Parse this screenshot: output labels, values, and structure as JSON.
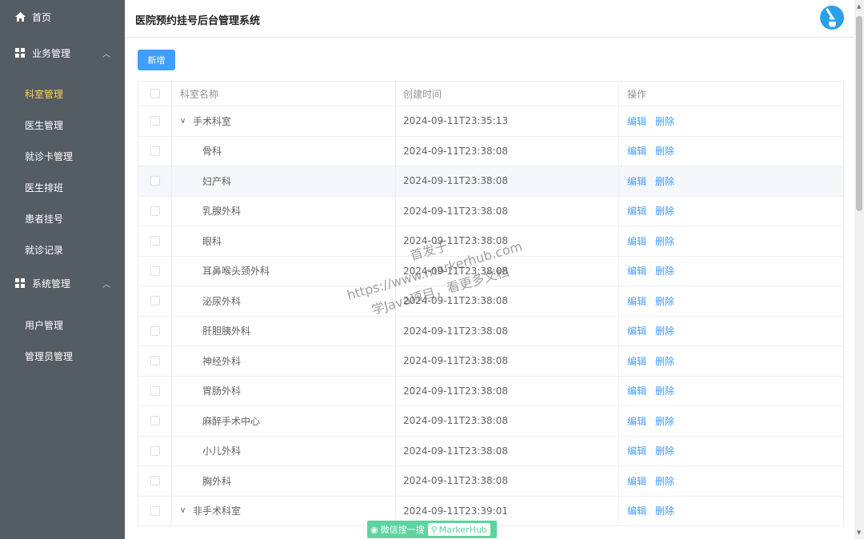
{
  "app": {
    "title": "医院预约挂号后台管理系统"
  },
  "sidebar": {
    "home": "首页",
    "groups": [
      {
        "label": "业务管理",
        "items": [
          "科室管理",
          "医生管理",
          "就诊卡管理",
          "医生排班",
          "患者挂号",
          "就诊记录"
        ]
      },
      {
        "label": "系统管理",
        "items": [
          "用户管理",
          "管理员管理"
        ]
      }
    ],
    "active": "科室管理"
  },
  "toolbar": {
    "add_label": "新增"
  },
  "table": {
    "columns": [
      "科室名称",
      "创建时间",
      "操作"
    ],
    "edit_label": "编辑",
    "delete_label": "删除",
    "rows": [
      {
        "name": "手术科室",
        "time": "2024-09-11T23:35:13",
        "parent": true
      },
      {
        "name": "骨科",
        "time": "2024-09-11T23:38:08"
      },
      {
        "name": "妇产科",
        "time": "2024-09-11T23:38:08"
      },
      {
        "name": "乳腺外科",
        "time": "2024-09-11T23:38:08"
      },
      {
        "name": "眼科",
        "time": "2024-09-11T23:38:08"
      },
      {
        "name": "耳鼻喉头颈外科",
        "time": "2024-09-11T23:38:08"
      },
      {
        "name": "泌尿外科",
        "time": "2024-09-11T23:38:08"
      },
      {
        "name": "肝胆胰外科",
        "time": "2024-09-11T23:38:08"
      },
      {
        "name": "神经外科",
        "time": "2024-09-11T23:38:08"
      },
      {
        "name": "胃肠外科",
        "time": "2024-09-11T23:38:08"
      },
      {
        "name": "麻醉手术中心",
        "time": "2024-09-11T23:38:08"
      },
      {
        "name": "小儿外科",
        "time": "2024-09-11T23:38:08"
      },
      {
        "name": "胸外科",
        "time": "2024-09-11T23:38:08"
      },
      {
        "name": "非手术科室",
        "time": "2024-09-11T23:39:01",
        "parent": true
      }
    ]
  },
  "watermark": {
    "line1": "首发于",
    "line2": "https://www.markerhub.com",
    "line3": "学Java项目，看更多文档",
    "badge_left": "微信搜一搜",
    "badge_right": "MarkerHub"
  },
  "colors": {
    "sidebar_bg": "#545c64",
    "active": "#ffd04b",
    "primary": "#409eff"
  }
}
